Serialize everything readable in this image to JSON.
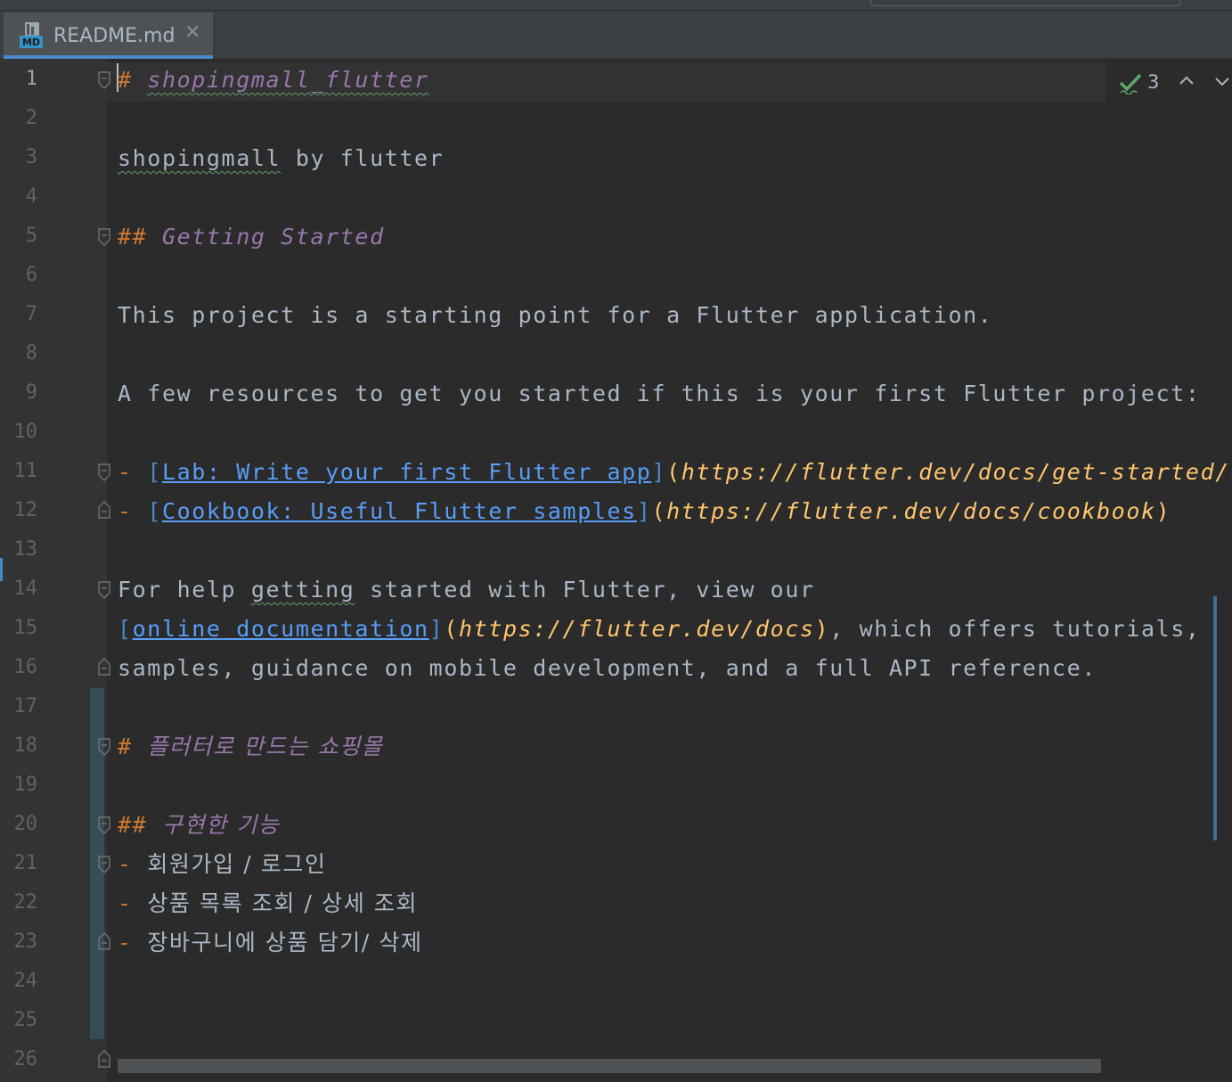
{
  "tab": {
    "icon": "markdown-file-icon",
    "title": "README.md",
    "close_icon": "close-icon",
    "close_symbol": "✕"
  },
  "inspection": {
    "icon": "inspection-ok-icon",
    "count": "3",
    "up_icon": "chevron-up-icon",
    "down_icon": "chevron-down-icon"
  },
  "line_numbers": [
    "1",
    "2",
    "3",
    "4",
    "5",
    "6",
    "7",
    "8",
    "9",
    "10",
    "11",
    "12",
    "13",
    "14",
    "15",
    "16",
    "17",
    "18",
    "19",
    "20",
    "21",
    "22",
    "23",
    "24",
    "25",
    "26"
  ],
  "lines": {
    "l1": {
      "hash": "#",
      "text": "shopingmall_flutter"
    },
    "l3": {
      "word1": "shopingmall",
      "rest": " by flutter"
    },
    "l5": {
      "hash": "##",
      "text": "Getting Started"
    },
    "l7": {
      "text": "This project is a starting point for a Flutter application."
    },
    "l9": {
      "text": "A few resources to get you started if this is your first Flutter project:"
    },
    "l11": {
      "dash": "-",
      "open": "[",
      "label": "Lab: Write your first Flutter app",
      "close": "]",
      "popen": "(",
      "url": "https://flutter.dev/docs/get-started/codelab"
    },
    "l12": {
      "dash": "-",
      "open": "[",
      "label": "Cookbook: Useful Flutter samples",
      "close": "]",
      "popen": "(",
      "url": "https://flutter.dev/docs/cookbook",
      "pclose": ")"
    },
    "l14": {
      "pre": "For help ",
      "word": "getting",
      "post": " started with Flutter, view our"
    },
    "l15": {
      "open": "[",
      "label": "online documentation",
      "close": "]",
      "popen": "(",
      "url": "https://flutter.dev/docs",
      "pclose": ")",
      "rest": ", which offers tutorials,"
    },
    "l16": {
      "text": "samples, guidance on mobile development, and a full API reference."
    },
    "l18": {
      "hash": "#",
      "text": "플러터로 만드는 쇼핑몰"
    },
    "l20": {
      "hash": "##",
      "text": "구현한 기능"
    },
    "l21": {
      "dash": "-",
      "text": "회원가입 / 로그인"
    },
    "l22": {
      "dash": "-",
      "text": "상품 목록 조회 / 상세 조회"
    },
    "l23": {
      "dash": "-",
      "text": "장바구니에 상품 담기/ 삭제"
    }
  },
  "colors": {
    "background": "#2b2b2b",
    "gutter": "#313335",
    "heading": "#9876aa",
    "markup": "#cc7832",
    "link": "#589df6",
    "url": "#ffc66d",
    "text": "#a9b7c6"
  }
}
